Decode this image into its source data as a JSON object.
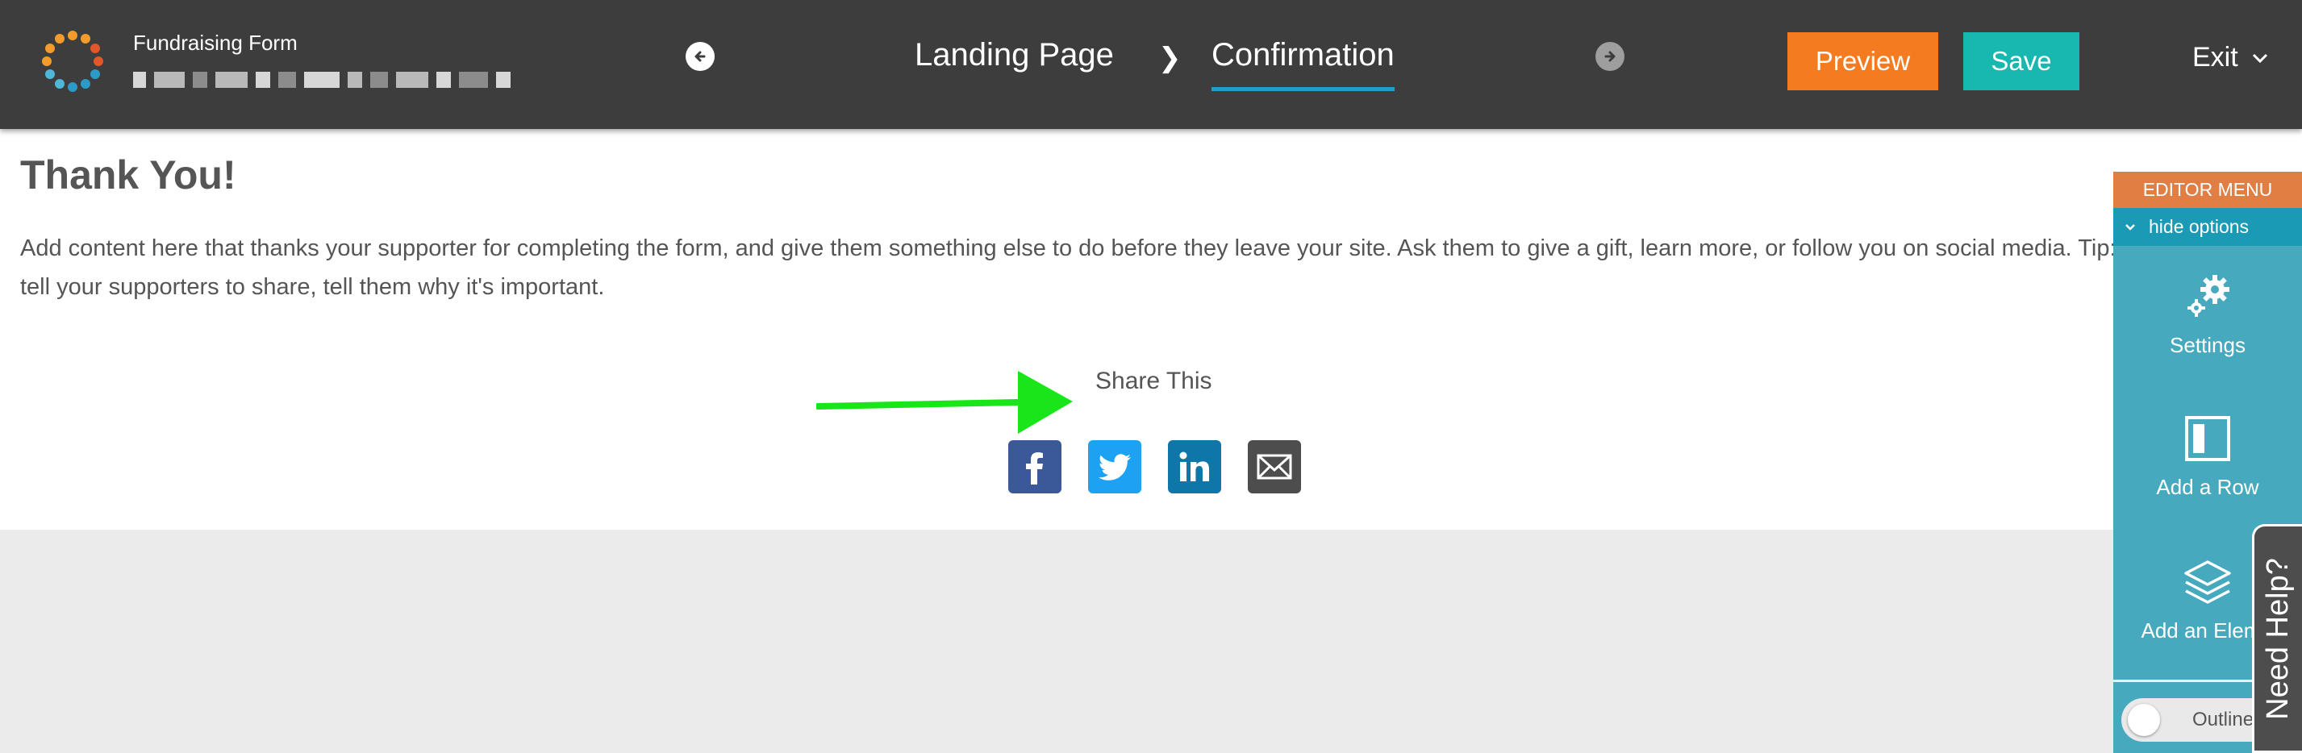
{
  "header": {
    "form_type": "Fundraising Form",
    "steps": [
      "Landing Page",
      "Confirmation"
    ],
    "step_separator": "❯",
    "active_step": "Confirmation",
    "preview_label": "Preview",
    "save_label": "Save",
    "exit_label": "Exit",
    "icons": {
      "prev": "arrow-left-circle-icon",
      "next": "arrow-right-circle-icon",
      "exit": "chevron-down-icon"
    }
  },
  "content": {
    "title": "Thank You!",
    "body": "Add content here that thanks your supporter for completing the form, and give them something else to do before they leave your site. Ask them to give a gift, learn more, or follow you on social media. Tip: Don't just tell your supporters to share, tell them why it's important.",
    "share_title": "Share This",
    "share_icons": [
      "facebook-icon",
      "twitter-icon",
      "linkedin-icon",
      "email-icon"
    ],
    "annotation": "green-arrow"
  },
  "editor_menu": {
    "title": "EDITOR MENU",
    "hide_options": "hide options",
    "items": [
      {
        "label": "Settings",
        "icon": "gears-icon"
      },
      {
        "label": "Add a Row",
        "icon": "row-layout-icon"
      },
      {
        "label": "Add an Element",
        "icon": "layers-icon"
      }
    ],
    "outline_label": "Outline",
    "outline_on": false
  },
  "need_help": "Need Help?",
  "colors": {
    "topbar": "#3d3d3d",
    "preview": "#f47b20",
    "save": "#18b7b0",
    "editor_head": "#e07e44",
    "editor_body": "#47a9be",
    "active_underline": "#1ea0c8"
  }
}
